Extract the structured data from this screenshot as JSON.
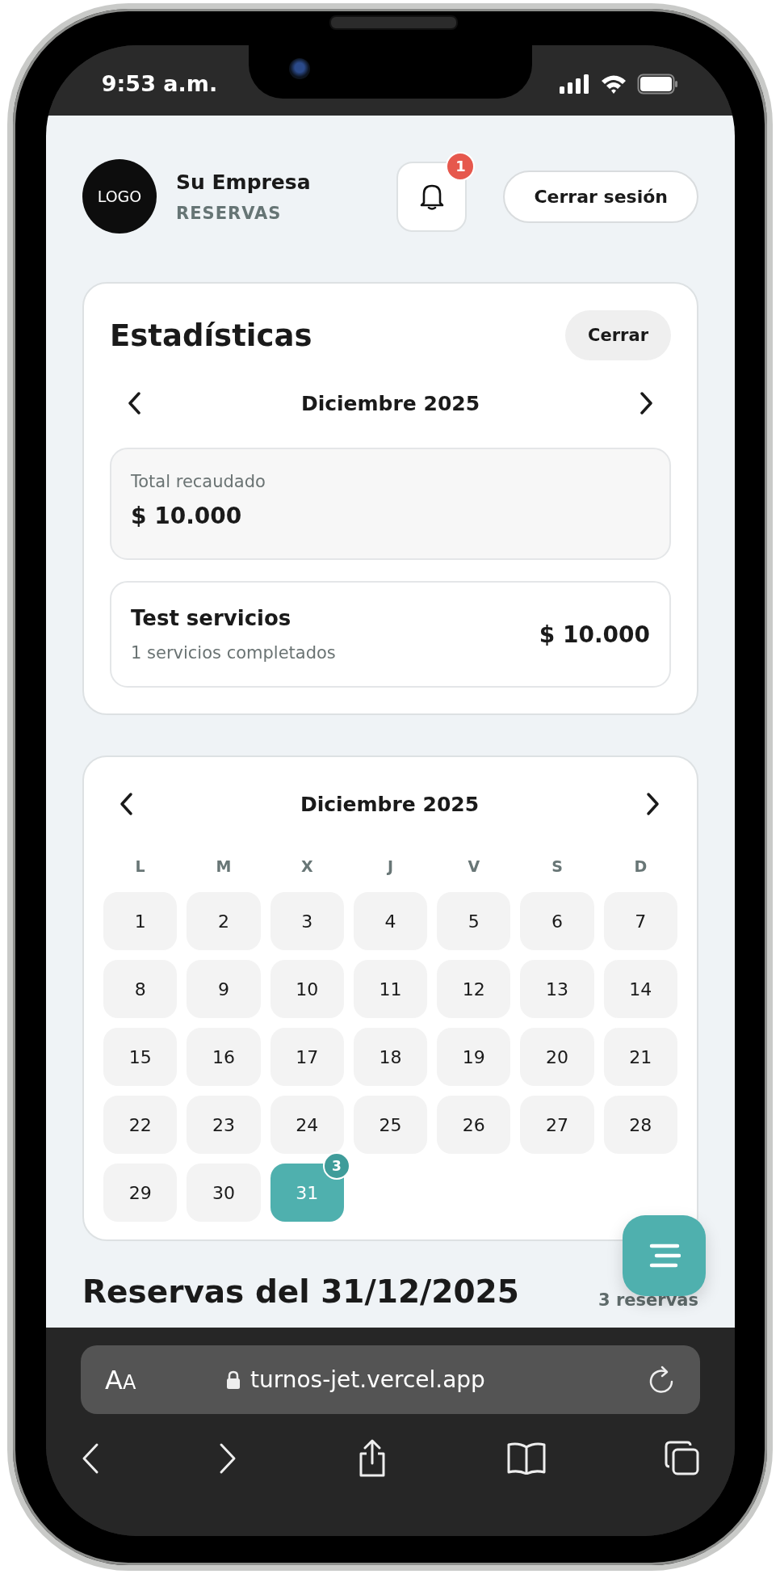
{
  "status_bar": {
    "time": "9:53 a.m."
  },
  "header": {
    "logo": "LOGO",
    "company": "Su Empresa",
    "section": "RESERVAS",
    "notification_count": "1",
    "logout": "Cerrar sesión"
  },
  "stats": {
    "title": "Estadísticas",
    "close": "Cerrar",
    "month": "Diciembre 2025",
    "total_label": "Total recaudado",
    "total_value": "$ 10.000",
    "services": [
      {
        "name": "Test servicios",
        "detail": "1 servicios completados",
        "amount": "$ 10.000"
      }
    ]
  },
  "calendar": {
    "month": "Diciembre 2025",
    "weekdays": [
      "L",
      "M",
      "X",
      "J",
      "V",
      "S",
      "D"
    ],
    "days": [
      {
        "label": "1",
        "selected": false
      },
      {
        "label": "2",
        "selected": false
      },
      {
        "label": "3",
        "selected": false
      },
      {
        "label": "4",
        "selected": false
      },
      {
        "label": "5",
        "selected": false
      },
      {
        "label": "6",
        "selected": false
      },
      {
        "label": "7",
        "selected": false
      },
      {
        "label": "8",
        "selected": false
      },
      {
        "label": "9",
        "selected": false
      },
      {
        "label": "10",
        "selected": false
      },
      {
        "label": "11",
        "selected": false
      },
      {
        "label": "12",
        "selected": false
      },
      {
        "label": "13",
        "selected": false
      },
      {
        "label": "14",
        "selected": false
      },
      {
        "label": "15",
        "selected": false
      },
      {
        "label": "16",
        "selected": false
      },
      {
        "label": "17",
        "selected": false
      },
      {
        "label": "18",
        "selected": false
      },
      {
        "label": "19",
        "selected": false
      },
      {
        "label": "20",
        "selected": false
      },
      {
        "label": "21",
        "selected": false
      },
      {
        "label": "22",
        "selected": false
      },
      {
        "label": "23",
        "selected": false
      },
      {
        "label": "24",
        "selected": false
      },
      {
        "label": "25",
        "selected": false
      },
      {
        "label": "26",
        "selected": false
      },
      {
        "label": "27",
        "selected": false
      },
      {
        "label": "28",
        "selected": false
      },
      {
        "label": "29",
        "selected": false
      },
      {
        "label": "30",
        "selected": false
      },
      {
        "label": "31",
        "selected": true,
        "badge": "3"
      }
    ]
  },
  "reservations": {
    "title": "Reservas del 31/12/2025",
    "count": "3 reservas"
  },
  "browser": {
    "text_size": "AA",
    "url": "turnos-jet.vercel.app"
  }
}
